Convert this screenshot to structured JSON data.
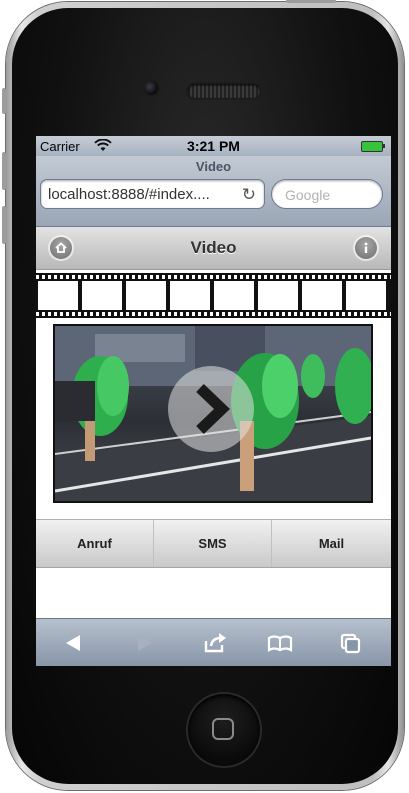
{
  "status_bar": {
    "carrier": "Carrier",
    "time": "3:21 PM"
  },
  "browser": {
    "page_title": "Video",
    "url": "localhost:8888/#index....",
    "search_placeholder": "Google"
  },
  "header": {
    "title": "Video"
  },
  "tabs": [
    {
      "label": "Anruf"
    },
    {
      "label": "SMS"
    },
    {
      "label": "Mail"
    }
  ],
  "toolbar": {
    "icons": [
      "back-arrow-icon",
      "forward-arrow-icon",
      "share-icon",
      "bookmarks-icon",
      "pages-icon"
    ]
  },
  "colors": {
    "battery": "#37c43a",
    "browser_chrome": "#a7b2c0",
    "header_bar": "#c9c9c9",
    "toolbar": "#8795a8"
  }
}
